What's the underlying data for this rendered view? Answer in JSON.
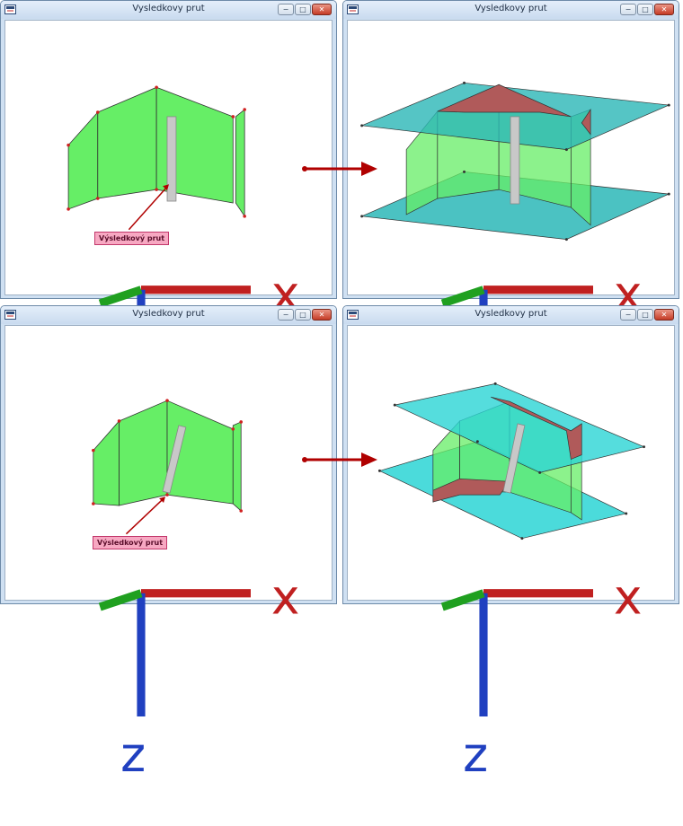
{
  "windows": [
    {
      "title": "Vysledkovy prut"
    },
    {
      "title": "Vysledkovy prut"
    },
    {
      "title": "Vysledkovy prut"
    },
    {
      "title": "Vysledkovy prut"
    }
  ],
  "window_buttons": {
    "minimize": "−",
    "maximize": "□",
    "close": "✕"
  },
  "callout_label": "Výsledkový prut",
  "axis_labels": {
    "x": "x",
    "z": "z"
  },
  "colors": {
    "wall_green": "#66ee66",
    "plane_cyan": "#2bb7b7",
    "cut_red": "#b05a5a",
    "arrow_red": "#b00000",
    "callout_pink": "#f7a8c2"
  }
}
